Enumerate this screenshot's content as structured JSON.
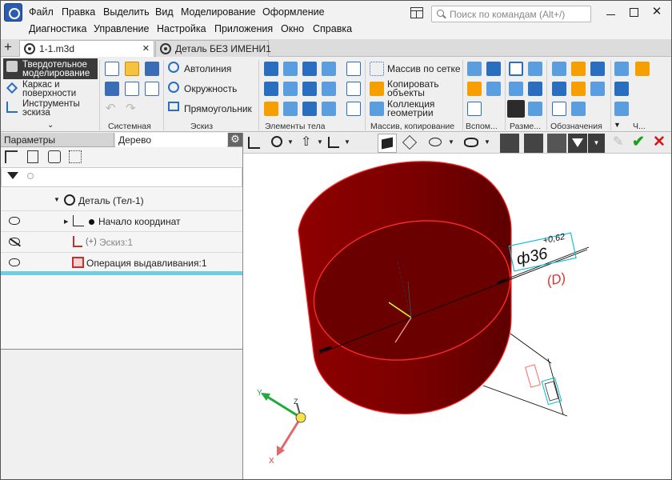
{
  "menu": {
    "row1": [
      "Файл",
      "Правка",
      "Выделить",
      "Вид",
      "Моделирование",
      "Оформление"
    ],
    "row2": [
      "Диагностика",
      "Управление",
      "Настройка",
      "Приложения",
      "Окно",
      "Справка"
    ]
  },
  "search": {
    "placeholder": "Поиск по командам (Alt+/)"
  },
  "tabs": [
    {
      "label": "1-1.m3d",
      "active": true
    },
    {
      "label": "Деталь БЕЗ ИМЕНИ1",
      "active": false
    }
  ],
  "ribbon": {
    "modes": [
      "Твердотельное моделирование",
      "Каркас и поверхности",
      "Инструменты эскиза"
    ],
    "sketch_commands": [
      "Автолиния",
      "Окружность",
      "Прямоугольник"
    ],
    "array_commands": [
      "Массив по сетке",
      "Копировать объекты",
      "Коллекция геометрии"
    ],
    "groups": [
      "Системная",
      "Эскиз",
      "Элементы тела",
      "Массив, копирование",
      "Вспом...",
      "Разме...",
      "Обозначения",
      "Ч..."
    ]
  },
  "panel": {
    "tabs": [
      "Параметры",
      "Дерево"
    ],
    "tree": [
      {
        "label": "Деталь (Тел-1)"
      },
      {
        "label": "Начало координат"
      },
      {
        "label": "Эскиз:1",
        "dimmed": true
      },
      {
        "label": "Операция выдавливания:1"
      }
    ]
  },
  "viewport": {
    "dimension": {
      "value": "ф36",
      "tolerance": "+0,62",
      "note": "(D)"
    },
    "axes": {
      "x": "X",
      "y": "Y",
      "z": "Z"
    },
    "colors": {
      "body": "#7a0000",
      "edge": "#ff2a2a",
      "frame": "#00bcd4",
      "accept": "#1aa31a",
      "cancel": "#d01818"
    }
  }
}
